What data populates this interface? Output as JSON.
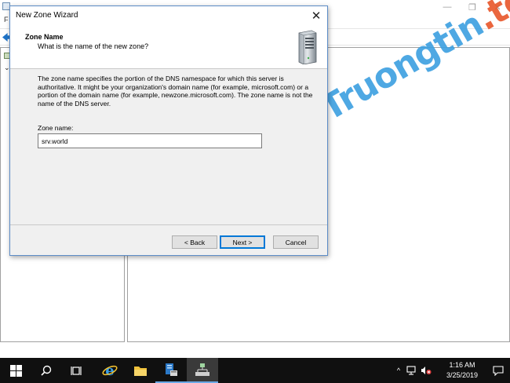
{
  "background_window": {
    "controls": {
      "minimize": "—",
      "maximize": "❐",
      "close": "✕"
    },
    "menu_initial": "F"
  },
  "watermark": {
    "main": "Truongtin",
    "tld": ".top"
  },
  "wizard": {
    "title": "New Zone Wizard",
    "close_glyph": "✕",
    "header_title": "Zone Name",
    "header_subtitle": "What is the name of the new zone?",
    "description": "The zone name specifies the portion of the DNS namespace for which this server is authoritative. It might be your organization's domain name (for example, microsoft.com) or a portion of the domain name (for example, newzone.microsoft.com). The zone name is not the name of the DNS server.",
    "zone_name_label": "Zone name:",
    "zone_name_value": "srv.world",
    "buttons": {
      "back": "< Back",
      "next": "Next >",
      "cancel": "Cancel"
    }
  },
  "taskbar": {
    "icons": [
      "windows-logo-icon",
      "search-icon",
      "task-view-icon",
      "internet-explorer-icon",
      "file-explorer-icon",
      "server-manager-icon",
      "dns-manager-icon"
    ],
    "tray_chevron": "^",
    "clock_time": "1:16 AM",
    "clock_date": "3/25/2019"
  },
  "colors": {
    "accent": "#0078d7",
    "taskbar": "#101010",
    "dialog_bg": "#f0f0f0",
    "watermark_blue": "#3b9fe0",
    "watermark_orange": "#e8562a"
  }
}
